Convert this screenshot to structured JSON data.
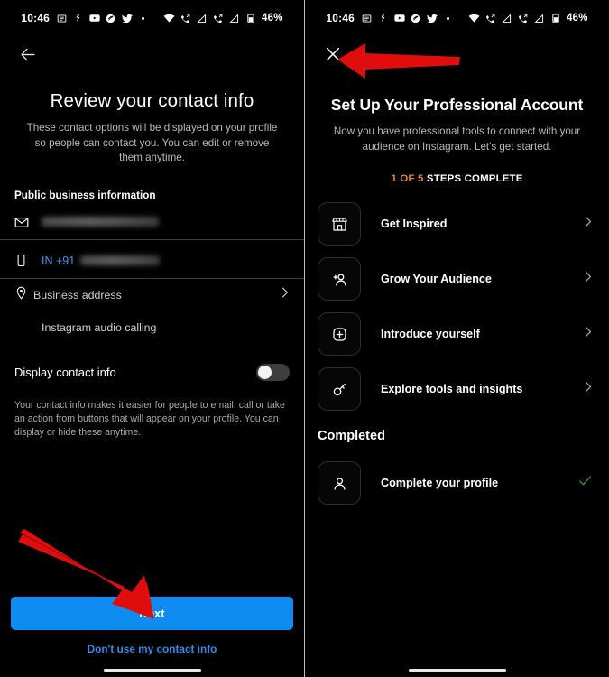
{
  "status_bar": {
    "time": "10:46",
    "battery": "46%",
    "icons": [
      "news-icon",
      "fitness-icon",
      "youtube-icon",
      "music-icon",
      "twitter-icon",
      "dot-icon",
      "wifi-icon",
      "missed-call-icon",
      "signal-icon",
      "missed-call-2-icon",
      "signal-2-icon",
      "battery-icon"
    ]
  },
  "left_screen": {
    "back_label": "back-arrow",
    "title": "Review your contact info",
    "subtitle": "These contact options will be displayed on your profile so people can contact you. You can edit or remove them anytime.",
    "section_label": "Public business information",
    "fields": [
      {
        "icon": "email-icon",
        "value": "",
        "redacted": true
      },
      {
        "icon": "phone-icon",
        "prefix": "IN +91",
        "value": "",
        "redacted": true
      }
    ],
    "rows": [
      {
        "icon": "location-pin-icon",
        "label": "Business address",
        "chevron": "›"
      },
      {
        "icon": "",
        "label": "Instagram audio calling",
        "chevron": ""
      }
    ],
    "toggle": {
      "label": "Display contact info",
      "on": false
    },
    "helper_text": "Your contact info makes it easier for people to email, call or take an action from buttons that will appear on your profile. You can display or hide these anytime.",
    "primary_button": "Next",
    "secondary_link": "Don't use my contact info",
    "accent_color": "#0f8cf2",
    "link_color": "#2f8ce8"
  },
  "right_screen": {
    "close_label": "close-icon",
    "title": "Set Up Your Professional Account",
    "subtitle": "Now you have professional tools to connect with your audience on Instagram. Let's get started.",
    "steps_highlight": "1 OF 5",
    "steps_rest": " STEPS COMPLETE",
    "steps_color": "#e8833a",
    "tasks": [
      {
        "icon": "storefront-icon",
        "label": "Get Inspired",
        "chevron": "›"
      },
      {
        "icon": "add-person-icon",
        "label": "Grow Your Audience",
        "chevron": "›"
      },
      {
        "icon": "plus-square-icon",
        "label": "Introduce yourself",
        "chevron": "›"
      },
      {
        "icon": "key-icon",
        "label": "Explore tools and insights",
        "chevron": "›"
      }
    ],
    "completed_heading": "Completed",
    "completed_tasks": [
      {
        "icon": "person-icon",
        "label": "Complete your profile",
        "check": "✓",
        "check_color": "#2f8f4e"
      }
    ]
  }
}
